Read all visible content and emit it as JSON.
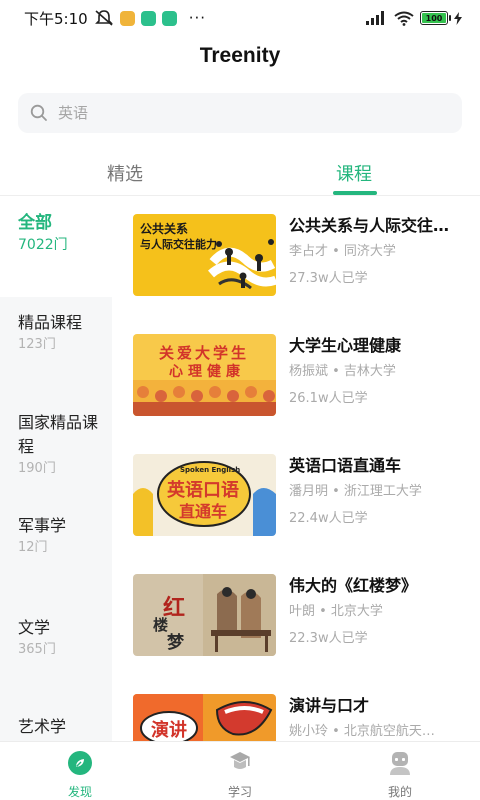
{
  "status_bar": {
    "time": "下午5:10",
    "dots": "···",
    "battery": "100"
  },
  "app": {
    "title": "Treenity"
  },
  "search": {
    "placeholder": "英语"
  },
  "tabs": [
    {
      "label": "精选",
      "active": false
    },
    {
      "label": "课程",
      "active": true
    }
  ],
  "colors": {
    "accent": "#24b67e",
    "sidebar_bg": "#f6f7f8",
    "muted_text": "#aaaaaa"
  },
  "sidebar": {
    "items": [
      {
        "label": "全部",
        "count": "7022门",
        "active": true
      },
      {
        "label": "精品课程",
        "count": "123门"
      },
      {
        "label": "国家精品课程",
        "count": "190门"
      },
      {
        "label": "军事学",
        "count": "12门"
      },
      {
        "label": "文学",
        "count": "365门"
      },
      {
        "label": "艺术学",
        "count": ""
      }
    ]
  },
  "courses": [
    {
      "title": "公共关系与人际交往…",
      "meta": "李占才 • 同济大学",
      "learners": "27.3w人已学",
      "thumb_text": [
        "公共关系",
        "与人际交往能力"
      ]
    },
    {
      "title": "大学生心理健康",
      "meta": "杨振斌 • 吉林大学",
      "learners": "26.1w人已学",
      "thumb_text": [
        "关爱大学生",
        "心理健康"
      ]
    },
    {
      "title": "英语口语直通车",
      "meta": "潘月明 • 浙江理工大学",
      "learners": "22.4w人已学",
      "thumb_text": [
        "Spoken English",
        "英语口语",
        "直通车"
      ]
    },
    {
      "title": "伟大的《红楼梦》",
      "meta": "叶朗 • 北京大学",
      "learners": "22.3w人已学",
      "thumb_text": [
        "红",
        "楼",
        "梦"
      ]
    },
    {
      "title": "演讲与口才",
      "meta": "姚小玲 • 北京航空航天…",
      "learners": "",
      "thumb_text": [
        "演讲"
      ]
    }
  ],
  "bottom_nav": [
    {
      "label": "发现",
      "icon": "discover-icon",
      "active": true
    },
    {
      "label": "学习",
      "icon": "study-icon",
      "active": false
    },
    {
      "label": "我的",
      "icon": "profile-icon",
      "active": false
    }
  ]
}
